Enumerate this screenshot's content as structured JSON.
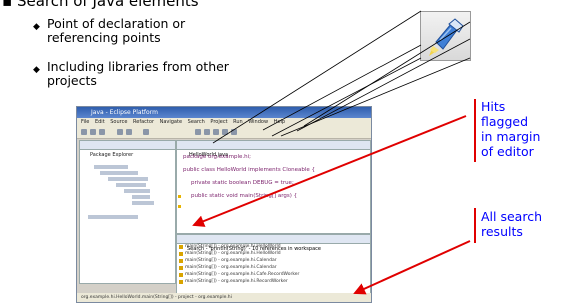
{
  "heading": "Search of Java elements",
  "bullets": [
    {
      "lines": [
        "Point of declaration or",
        "referencing points"
      ]
    },
    {
      "lines": [
        "Including libraries from other",
        "projects"
      ]
    }
  ],
  "callouts": {
    "hits": [
      "Hits",
      "flagged",
      "in margin",
      "of editor"
    ],
    "results": [
      "All search",
      "results"
    ]
  },
  "screenshot": {
    "title": "Java - Eclipse Platform",
    "menu": [
      "File",
      "Edit",
      "Source",
      "Refactor",
      "Navigate",
      "Search",
      "Project",
      "Run",
      "Window",
      "Help"
    ],
    "package_explorer_tab": "Package Explorer",
    "editor_tab": "HelloWorld.java",
    "code_lines": [
      "package org.example.hi;",
      "public class HelloWorld implements Cloneable {",
      "private static boolean DEBUG = true;",
      "public static void main(String[] args) {"
    ],
    "search_tab": "Search - 'println(String)' - 10 references in workspace",
    "search_results": [
      "main(String[]) - org.example.hi.HelloWorld",
      "main(String[]) - org.example.hi.HelloWorld",
      "main(String[]) - org.example.hi.Calendar",
      "main(String[]) - org.example.hi.Calendar",
      "main(String[]) - org.example.hi.Cafe.RecordWorker",
      "main(String[]) - org.example.hi.RecordWorker"
    ],
    "status": "org.example.hi.HelloWorld.main(String[]) - project - org.example.hi"
  },
  "colors": {
    "callout_text": "#0000ff",
    "callout_bar": "#e00000",
    "arrow": "#e00000"
  }
}
